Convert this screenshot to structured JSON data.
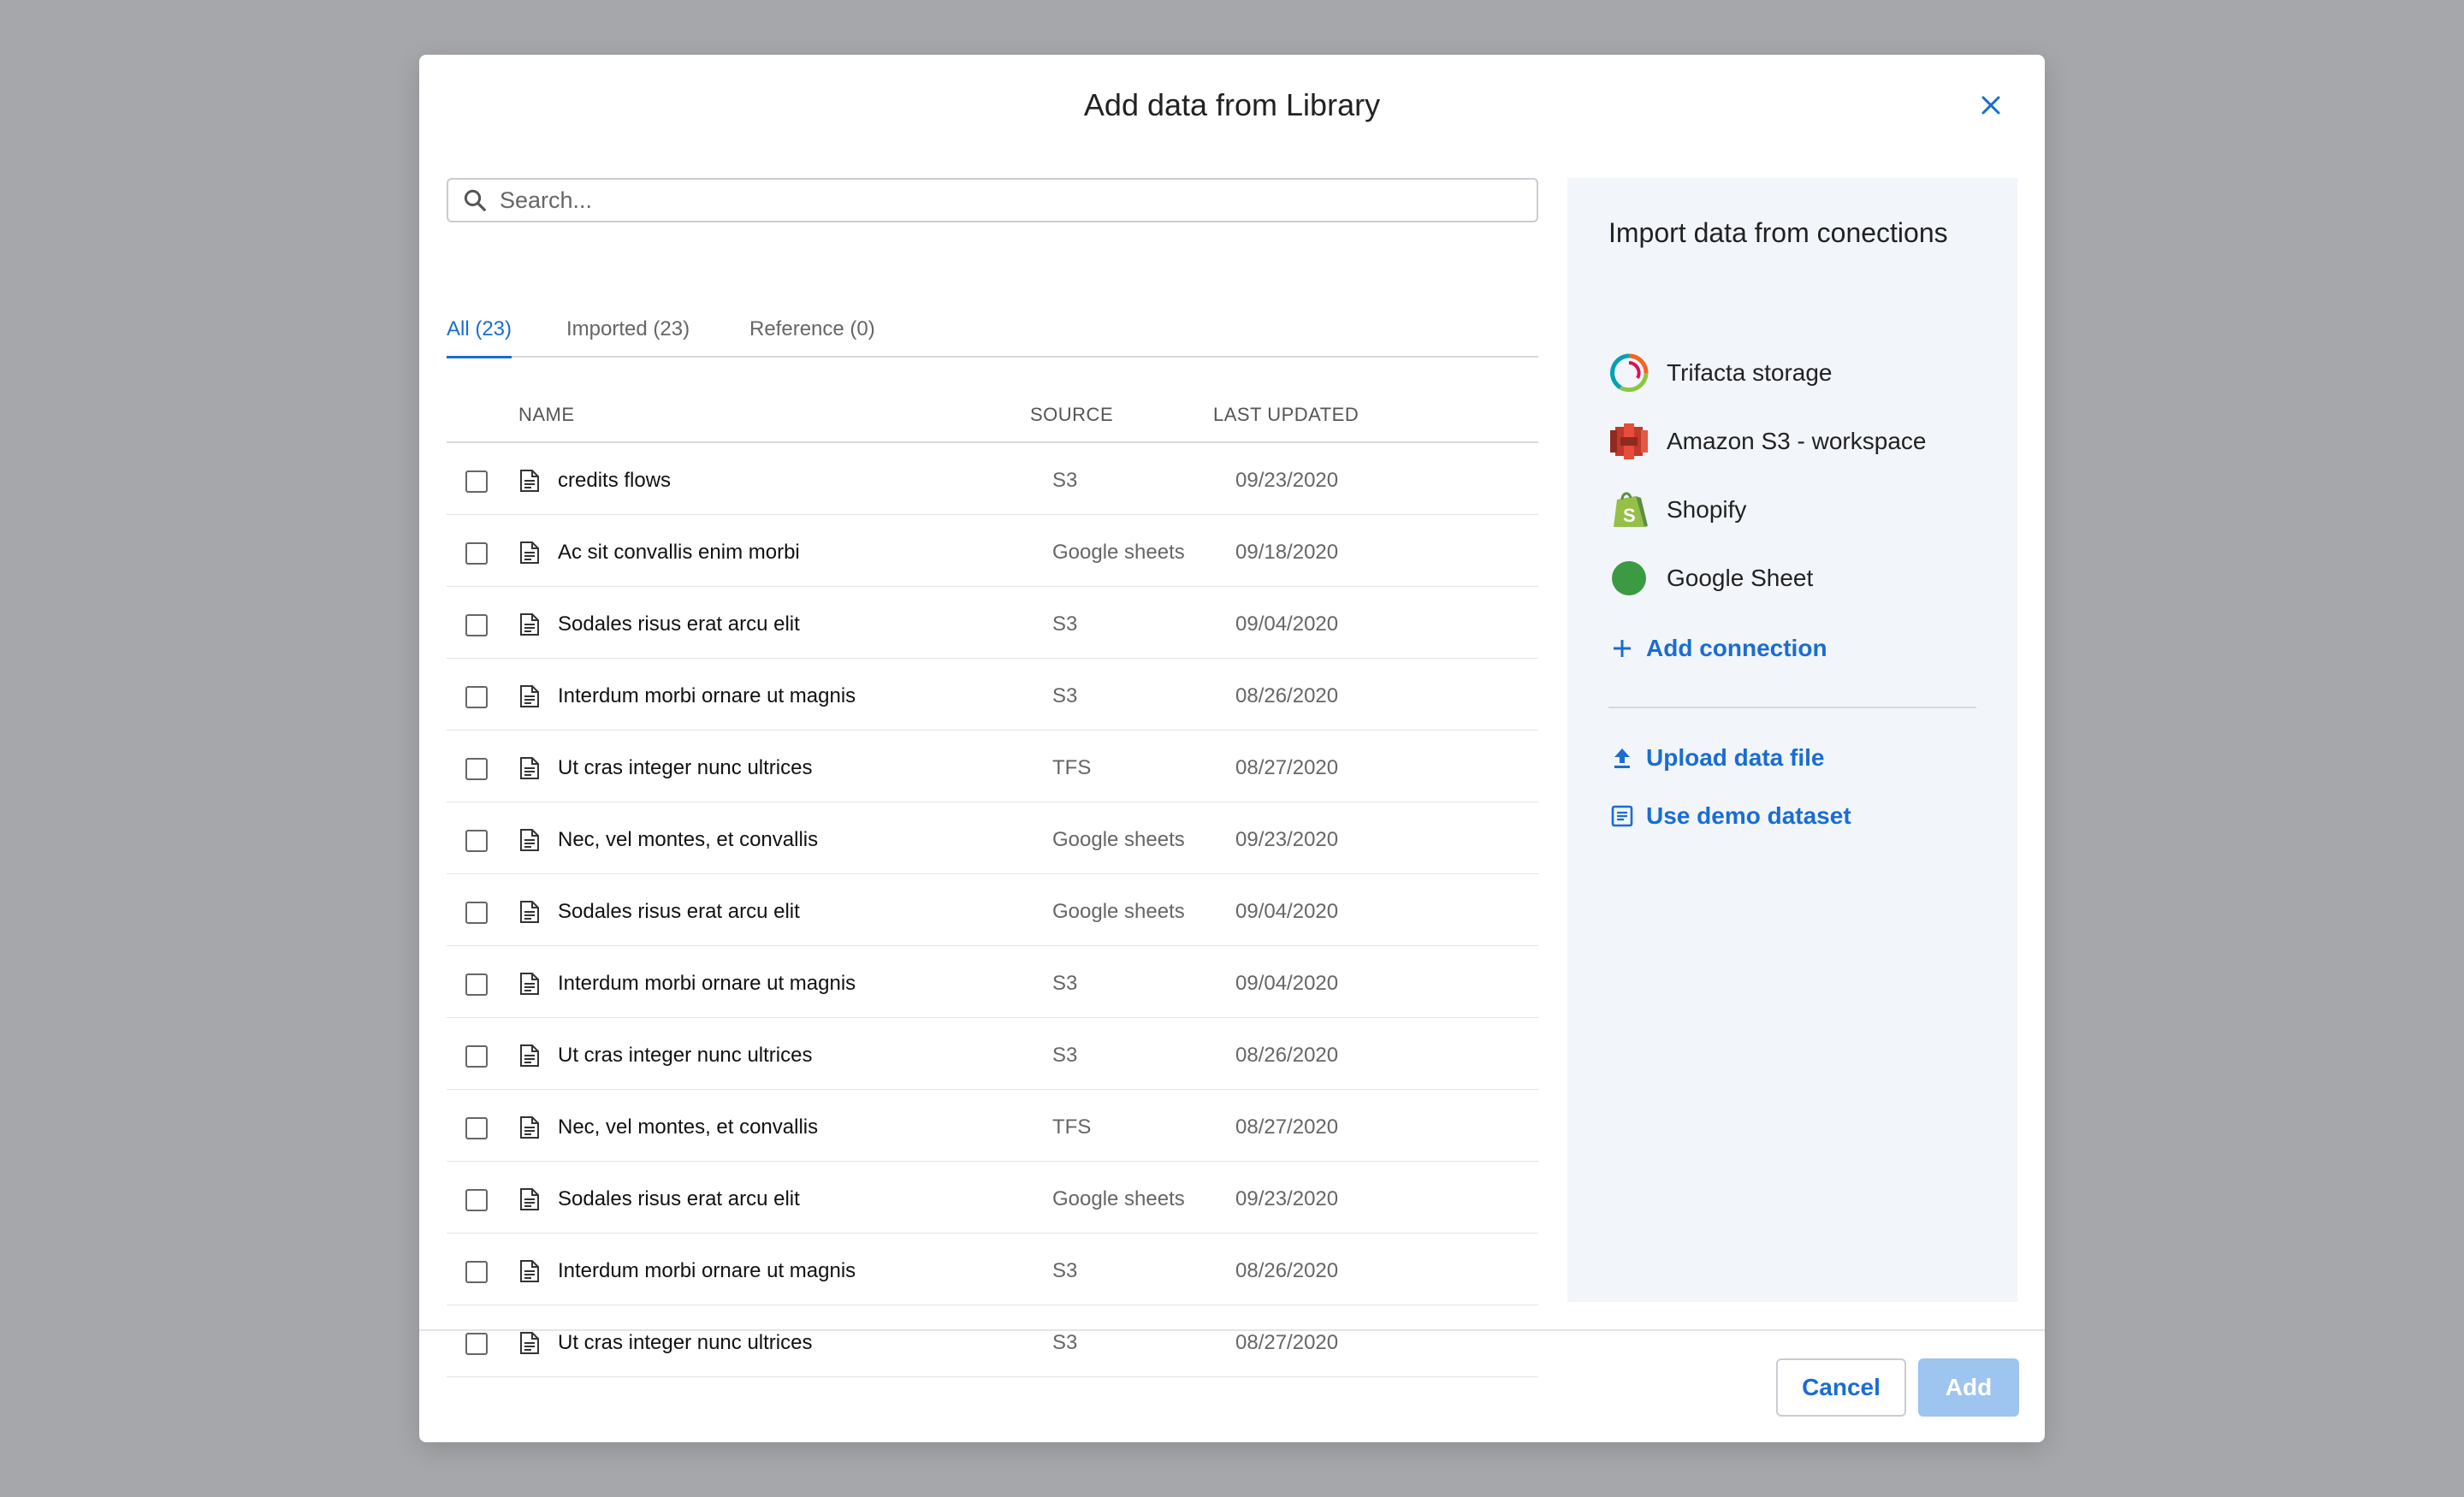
{
  "dialog": {
    "title": "Add data from Library",
    "close_icon": "close-icon"
  },
  "search": {
    "placeholder": "Search...",
    "value": ""
  },
  "tabs": [
    {
      "label": "All (23)",
      "active": true
    },
    {
      "label": "Imported (23)",
      "active": false
    },
    {
      "label": "Reference (0)",
      "active": false
    }
  ],
  "table": {
    "headers": {
      "name": "NAME",
      "source": "SOURCE",
      "updated": "LAST UPDATED"
    },
    "rows": [
      {
        "name": "credits flows",
        "source": "S3",
        "updated": "09/23/2020"
      },
      {
        "name": "Ac sit convallis enim morbi",
        "source": "Google sheets",
        "updated": "09/18/2020"
      },
      {
        "name": "Sodales risus erat arcu elit",
        "source": "S3",
        "updated": "09/04/2020"
      },
      {
        "name": "Interdum morbi ornare ut magnis",
        "source": "S3",
        "updated": "08/26/2020"
      },
      {
        "name": "Ut cras integer nunc ultrices",
        "source": "TFS",
        "updated": "08/27/2020"
      },
      {
        "name": "Nec, vel montes, et convallis",
        "source": "Google sheets",
        "updated": "09/23/2020"
      },
      {
        "name": "Sodales risus erat arcu elit",
        "source": "Google sheets",
        "updated": "09/04/2020"
      },
      {
        "name": "Interdum morbi ornare ut magnis",
        "source": "S3",
        "updated": "09/04/2020"
      },
      {
        "name": "Ut cras integer nunc ultrices",
        "source": "S3",
        "updated": "08/26/2020"
      },
      {
        "name": "Nec, vel montes, et convallis",
        "source": "TFS",
        "updated": "08/27/2020"
      },
      {
        "name": "Sodales risus erat arcu elit",
        "source": "Google sheets",
        "updated": "09/23/2020"
      },
      {
        "name": "Interdum morbi ornare ut magnis",
        "source": "S3",
        "updated": "08/26/2020"
      },
      {
        "name": "Ut cras integer nunc ultrices",
        "source": "S3",
        "updated": "08/27/2020"
      }
    ]
  },
  "connections": {
    "title": "Import data from conections",
    "items": [
      {
        "label": "Trifacta storage",
        "icon": "trifacta-logo-icon"
      },
      {
        "label": "Amazon S3 - workspace",
        "icon": "amazon-s3-logo-icon"
      },
      {
        "label": "Shopify",
        "icon": "shopify-logo-icon"
      },
      {
        "label": "Google Sheet",
        "icon": "google-sheet-logo-icon"
      }
    ],
    "add_connection": "Add connection",
    "upload": "Upload data file",
    "demo": "Use demo dataset"
  },
  "footer": {
    "cancel": "Cancel",
    "add": "Add"
  },
  "colors": {
    "accent": "#1a6dd1",
    "add_disabled": "#9ec4f0",
    "backdrop": "#a6a7aa",
    "panel": "#f2f5fa"
  }
}
